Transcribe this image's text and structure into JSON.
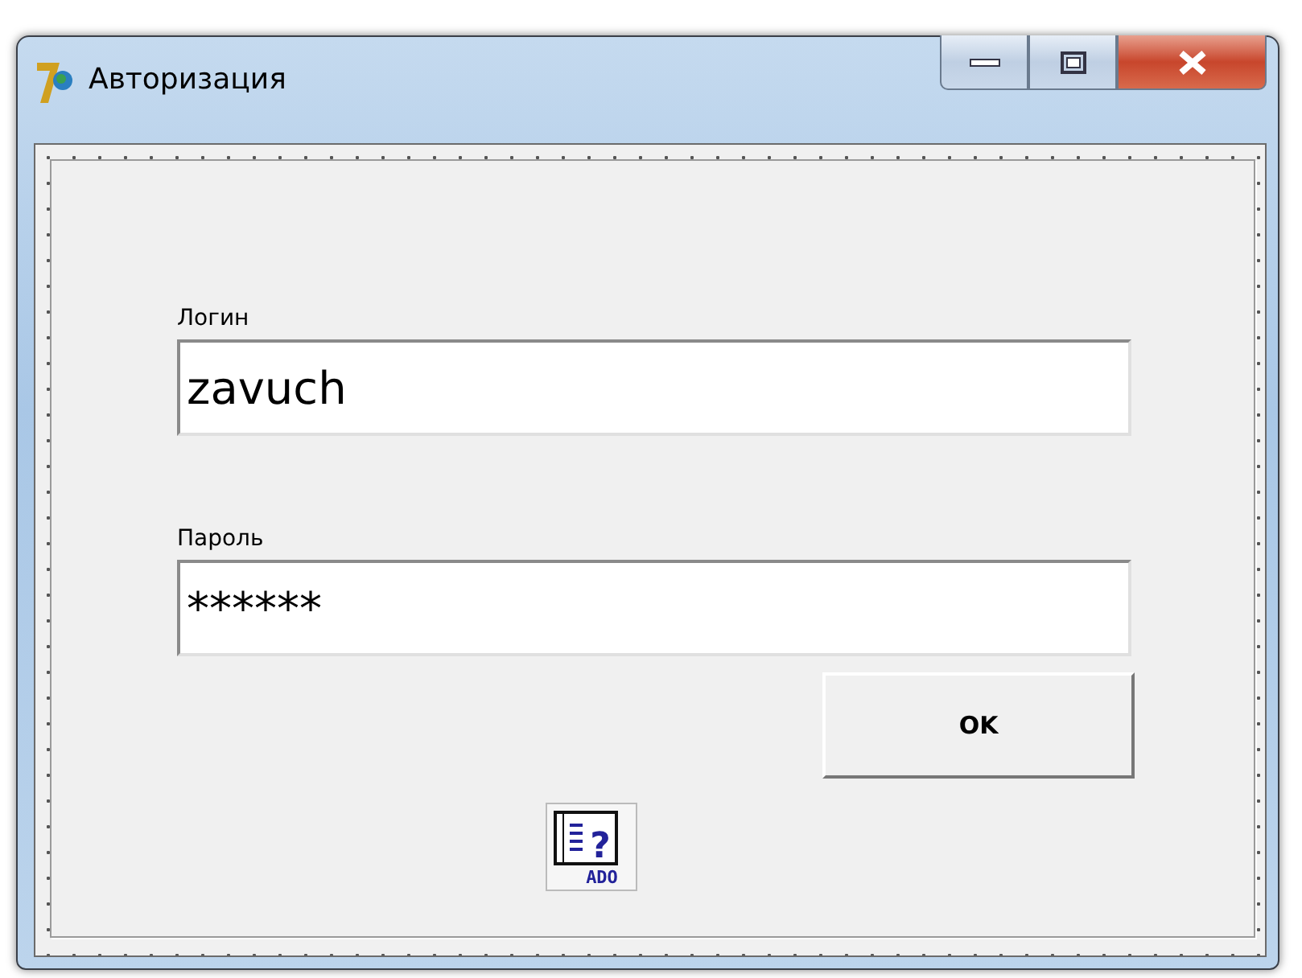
{
  "window": {
    "title": "Авторизация"
  },
  "fields": [
    {
      "label": "Логин",
      "value": "zavuch"
    },
    {
      "label": "Пароль",
      "value": "******"
    }
  ],
  "ok_button": {
    "label": "OK"
  },
  "ado_component": {
    "mark": "?",
    "caption": "ADO"
  }
}
